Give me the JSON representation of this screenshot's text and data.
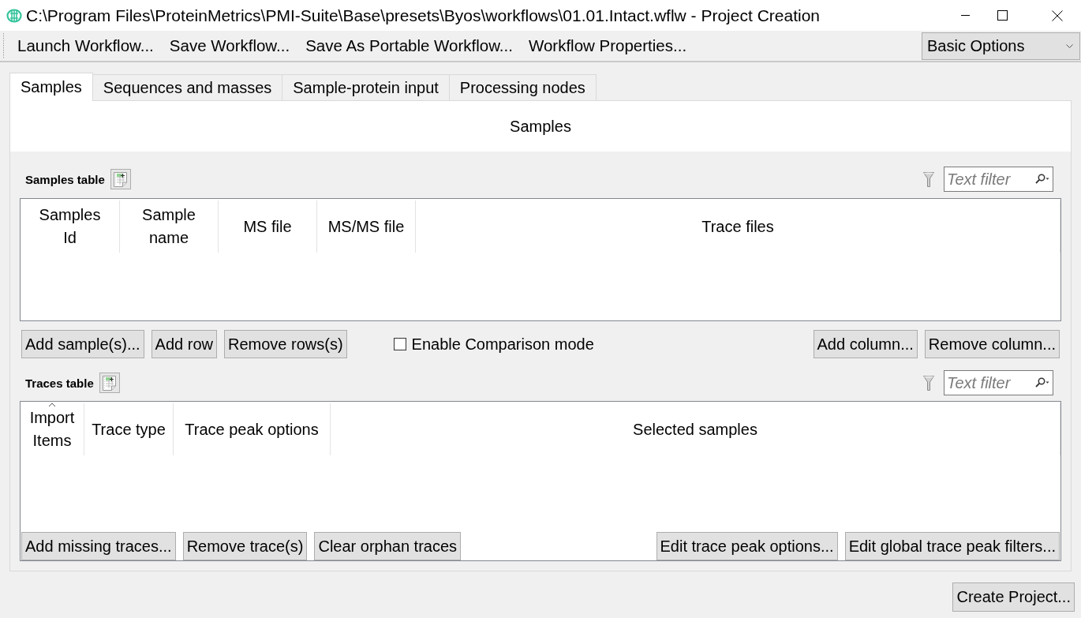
{
  "window": {
    "title": "C:\\Program Files\\ProteinMetrics\\PMI-Suite\\Base\\presets\\Byos\\workflows\\01.01.Intact.wflw - Project Creation"
  },
  "toolbar": {
    "actions": [
      "Launch Workflow...",
      "Save Workflow...",
      "Save As Portable Workflow...",
      "Workflow Properties..."
    ],
    "mode_select": {
      "value": "Basic Options"
    }
  },
  "tabs": [
    {
      "label": "Samples",
      "selected": true
    },
    {
      "label": "Sequences and masses",
      "selected": false
    },
    {
      "label": "Sample-protein input",
      "selected": false
    },
    {
      "label": "Processing nodes",
      "selected": false
    }
  ],
  "panel": {
    "title": "Samples"
  },
  "samples_table": {
    "label": "Samples table",
    "filter": {
      "placeholder": "Text filter"
    },
    "columns": [
      {
        "label": "Samples Id",
        "sorted": false
      },
      {
        "label": "Sample name",
        "sorted": false
      },
      {
        "label": "MS file",
        "sorted": false
      },
      {
        "label": "MS/MS file",
        "sorted": false
      },
      {
        "label": "Trace files",
        "sorted": false
      }
    ],
    "buttons_left": [
      "Add sample(s)...",
      "Add row",
      "Remove rows(s)"
    ],
    "comparison_mode": {
      "label": "Enable Comparison mode",
      "checked": false
    },
    "buttons_right": [
      "Add column...",
      "Remove column..."
    ]
  },
  "traces_table": {
    "label": "Traces table",
    "filter": {
      "placeholder": "Text filter"
    },
    "columns": [
      {
        "label": "Import Items",
        "sorted": true
      },
      {
        "label": "Trace type",
        "sorted": false
      },
      {
        "label": "Trace peak options",
        "sorted": false
      },
      {
        "label": "Selected samples",
        "sorted": false
      }
    ],
    "buttons_left": [
      "Add missing traces...",
      "Remove trace(s)",
      "Clear orphan traces"
    ],
    "buttons_right": [
      "Edit trace peak options...",
      "Edit global trace peak filters..."
    ]
  },
  "footer": {
    "create_button": "Create Project..."
  }
}
